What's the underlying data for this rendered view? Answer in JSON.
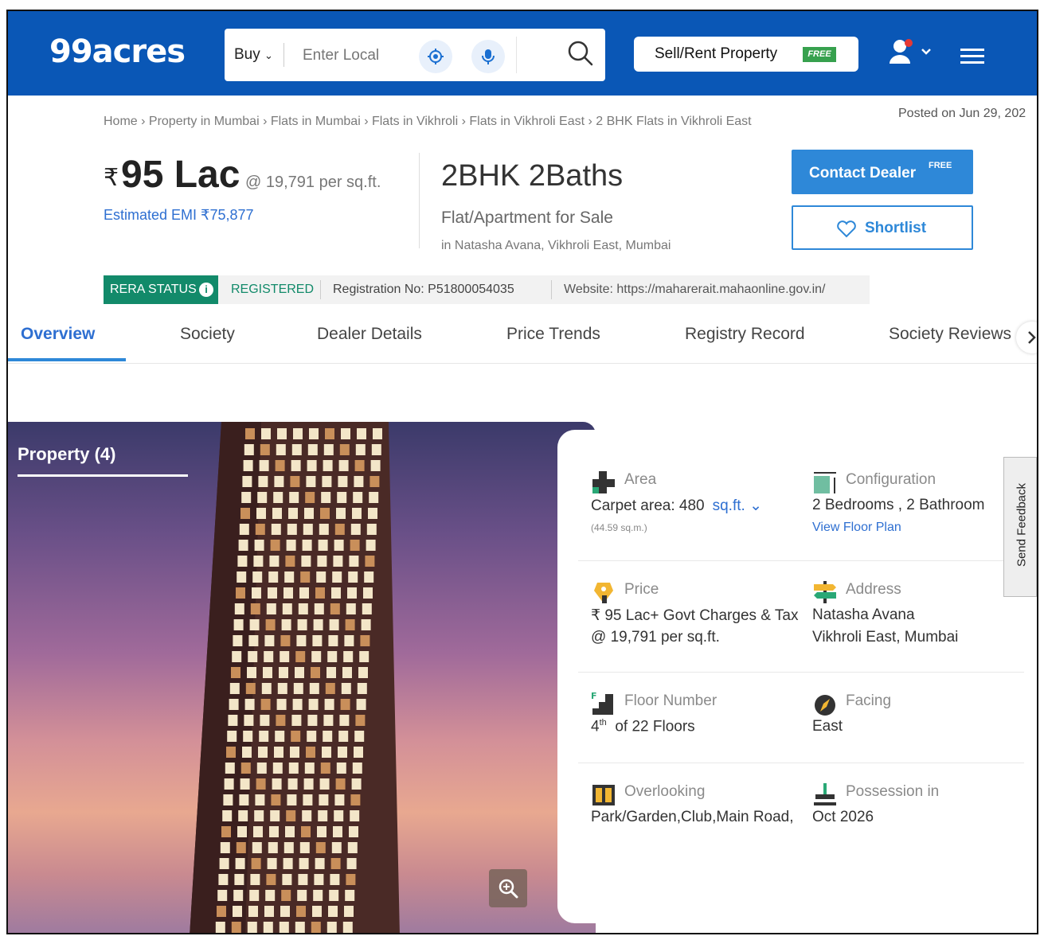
{
  "header": {
    "logo": "99acres",
    "search": {
      "mode": "Buy",
      "placeholder": "Enter Local"
    },
    "sell_label": "Sell/Rent Property",
    "free_tag": "FREE"
  },
  "breadcrumb": "Home › Property in Mumbai › Flats in Mumbai › Flats in Vikhroli › Flats in Vikhroli East › 2 BHK Flats in Vikhroli East",
  "posted": "Posted on Jun 29, 202",
  "summary": {
    "currency": "₹",
    "price": "95 Lac",
    "per_sqft": "@ 19,791 per sq.ft.",
    "emi": "Estimated EMI ₹75,877",
    "config": "2BHK 2Baths",
    "type": "Flat/Apartment for Sale",
    "location": "in Natasha Avana, Vikhroli East, Mumbai"
  },
  "actions": {
    "contact_label": "Contact Dealer",
    "contact_free": "FREE",
    "shortlist_label": "Shortlist"
  },
  "rera": {
    "status_label": "RERA STATUS",
    "info": "i",
    "status": "REGISTERED",
    "registration": "Registration No: P51800054035",
    "website": "Website: https://maharerait.mahaonline.gov.in/"
  },
  "tabs": [
    "Overview",
    "Society",
    "Dealer Details",
    "Price Trends",
    "Registry Record",
    "Society Reviews"
  ],
  "gallery": {
    "title": "Property (4)"
  },
  "details": {
    "area": {
      "label": "Area",
      "value": "Carpet area: 480",
      "unit": "sq.ft.",
      "sub": "(44.59 sq.m.)"
    },
    "configuration": {
      "label": "Configuration",
      "value": "2 Bedrooms , 2 Bathroom",
      "link": "View Floor Plan"
    },
    "price": {
      "label": "Price",
      "value": "₹ 95 Lac+ Govt Charges & Tax",
      "value2": "@ 19,791 per sq.ft."
    },
    "address": {
      "label": "Address",
      "value": "Natasha Avana",
      "value2": "Vikhroli East, Mumbai"
    },
    "floor": {
      "label": "Floor Number",
      "value_num": "4",
      "value_sup": "th",
      "value_rest": "of 22 Floors"
    },
    "facing": {
      "label": "Facing",
      "value": "East"
    },
    "overlooking": {
      "label": "Overlooking",
      "value": "Park/Garden,Club,Main Road,"
    },
    "possession": {
      "label": "Possession in",
      "value": "Oct 2026"
    }
  },
  "feedback": "Send Feedback",
  "colors": {
    "brand": "#0a57b6",
    "accent": "#2e88d8",
    "rera": "#128a6a",
    "free": "#37a14e"
  }
}
